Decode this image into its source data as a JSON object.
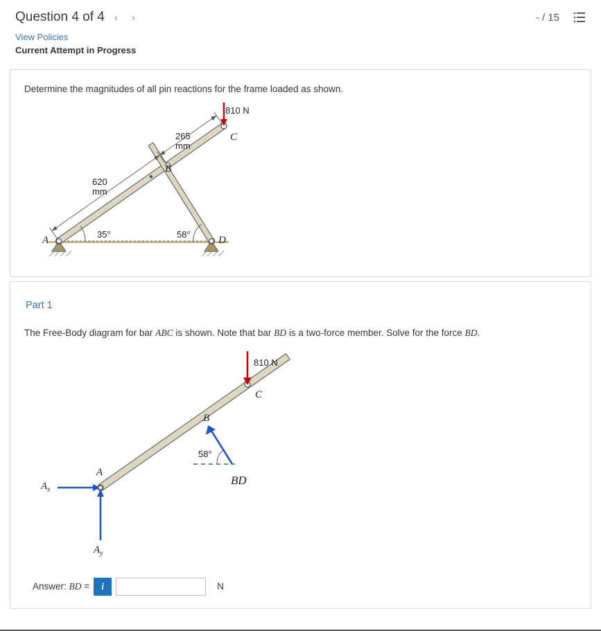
{
  "header": {
    "title": "Question 4 of 4",
    "nav_prev": "‹",
    "nav_next": "›",
    "score": "- / 15"
  },
  "links": {
    "view_policies": "View Policies",
    "attempt_status": "Current Attempt in Progress"
  },
  "problem": {
    "statement": "Determine the magnitudes of all pin reactions for the frame loaded as shown.",
    "diagram": {
      "force_load": "810 N",
      "dim_bc": "265",
      "dim_bc_unit": "mm",
      "dim_ab": "620",
      "dim_ab_unit": "mm",
      "angle_a": "35°",
      "angle_d": "58°",
      "pt_A": "A",
      "pt_B": "B",
      "pt_C": "C",
      "pt_D": "D"
    }
  },
  "part1": {
    "heading": "Part 1",
    "instruction_pre": "The Free-Body diagram for bar ",
    "instruction_abc": "ABC",
    "instruction_mid": " is shown. Note that bar ",
    "instruction_bd": "BD",
    "instruction_mid2": " is a two-force member. Solve for the force ",
    "instruction_bd2": "BD",
    "instruction_end": ".",
    "diagram": {
      "force_load": "810 N",
      "angle": "58°",
      "pt_A": "A",
      "pt_B": "B",
      "pt_C": "C",
      "reaction_Ax": "A",
      "reaction_Ax_sub": "x",
      "reaction_Ay": "A",
      "reaction_Ay_sub": "y",
      "force_BD": "BD"
    },
    "answer": {
      "label_pre": "Answer: ",
      "label_var": "BD",
      "label_eq": " = ",
      "value": "",
      "unit": "N"
    }
  }
}
